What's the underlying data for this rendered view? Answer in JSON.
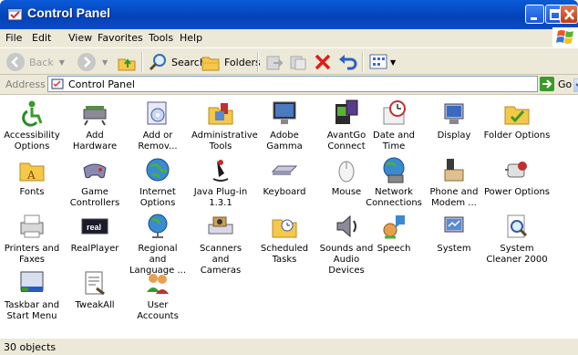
{
  "window": {
    "title": "Control Panel"
  },
  "menu": [
    "File",
    "Edit",
    "View",
    "Favorites",
    "Tools",
    "Help"
  ],
  "toolbar": {
    "back": "Back",
    "search": "Search",
    "folders": "Folders"
  },
  "address": {
    "label": "Address",
    "value": "Control Panel",
    "go": "Go"
  },
  "items": [
    {
      "label": "Accessibility\nOptions",
      "icon": "accessibility-icon"
    },
    {
      "label": "Add Hardware",
      "icon": "add-hardware-icon"
    },
    {
      "label": "Add or\nRemov...",
      "icon": "add-remove-programs-icon"
    },
    {
      "label": "Administrative\nTools",
      "icon": "administrative-tools-icon"
    },
    {
      "label": "Adobe Gamma",
      "icon": "monitor-icon"
    },
    {
      "label": "AvantGo\nConnect",
      "icon": "avantgo-icon"
    },
    {
      "label": "Date and Time",
      "icon": "clock-icon"
    },
    {
      "label": "Display",
      "icon": "display-icon"
    },
    {
      "label": "Folder Options",
      "icon": "folder-options-icon"
    },
    {
      "label": "Fonts",
      "icon": "fonts-folder-icon"
    },
    {
      "label": "Game\nControllers",
      "icon": "gamepad-icon"
    },
    {
      "label": "Internet\nOptions",
      "icon": "globe-icon"
    },
    {
      "label": "Java Plug-in\n1.3.1",
      "icon": "java-icon"
    },
    {
      "label": "Keyboard",
      "icon": "keyboard-icon"
    },
    {
      "label": "Mouse",
      "icon": "mouse-icon"
    },
    {
      "label": "Network\nConnections",
      "icon": "network-icon"
    },
    {
      "label": "Phone and\nModem ...",
      "icon": "phone-icon"
    },
    {
      "label": "Power Options",
      "icon": "power-icon"
    },
    {
      "label": "Printers and\nFaxes",
      "icon": "printer-icon"
    },
    {
      "label": "RealPlayer",
      "icon": "realplayer-icon"
    },
    {
      "label": "Regional and\nLanguage ...",
      "icon": "globe-stand-icon"
    },
    {
      "label": "Scanners and\nCameras",
      "icon": "scanner-icon"
    },
    {
      "label": "Scheduled\nTasks",
      "icon": "scheduled-tasks-icon"
    },
    {
      "label": "Sounds and\nAudio Devices",
      "icon": "speaker-icon"
    },
    {
      "label": "Speech",
      "icon": "speech-icon"
    },
    {
      "label": "System",
      "icon": "system-icon"
    },
    {
      "label": "System\nCleaner 2000",
      "icon": "magnifier-icon"
    },
    {
      "label": "Taskbar and\nStart Menu",
      "icon": "taskbar-icon"
    },
    {
      "label": "TweakAll",
      "icon": "tweak-icon"
    },
    {
      "label": "User Accounts",
      "icon": "users-icon"
    }
  ],
  "status": "30 objects",
  "colors": {
    "titlebar": "#0a5ad8",
    "chrome": "#ece9d8",
    "accent": "#3a9a2a"
  }
}
